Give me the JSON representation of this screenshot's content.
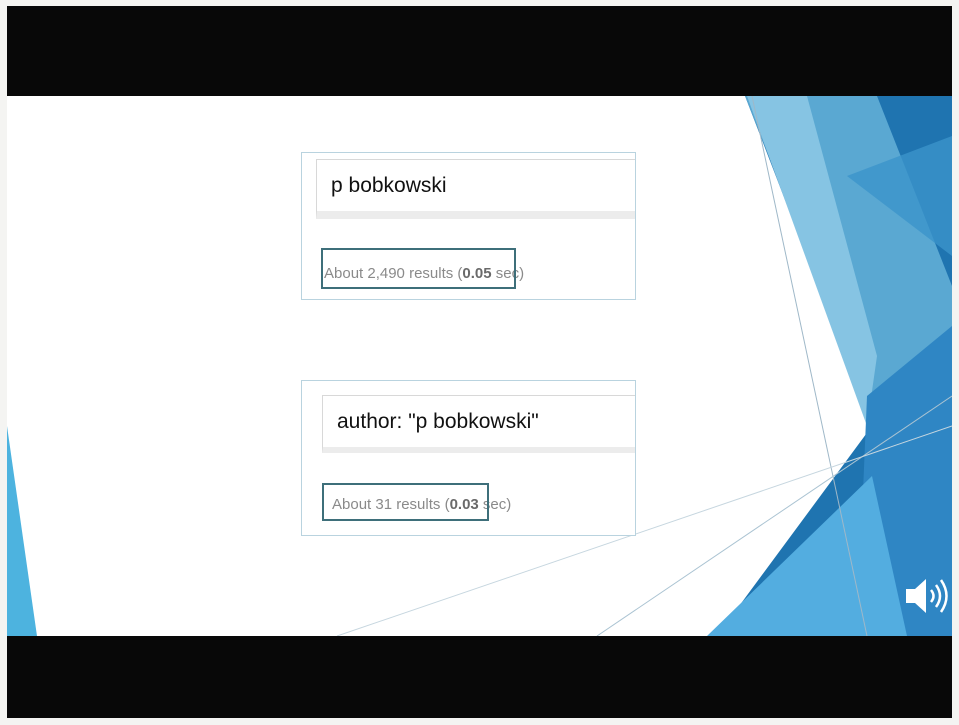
{
  "search_1": {
    "query": "p bobkowski",
    "results_prefix": "About 2,490 results (",
    "results_time": "0.05",
    "results_suffix": " sec)"
  },
  "search_2": {
    "query": "author: \"p bobkowski\"",
    "results_prefix": "About 31 results (",
    "results_time": "0.03",
    "results_suffix": " sec)"
  },
  "icons": {
    "audio": "speaker-icon"
  },
  "colors": {
    "letterbox": "#080808",
    "slide_background": "#ffffff",
    "accent_blue_dark": "#1f6aa5",
    "accent_blue_light": "#7cc3e6",
    "highlight_border": "#3e6f7a"
  }
}
